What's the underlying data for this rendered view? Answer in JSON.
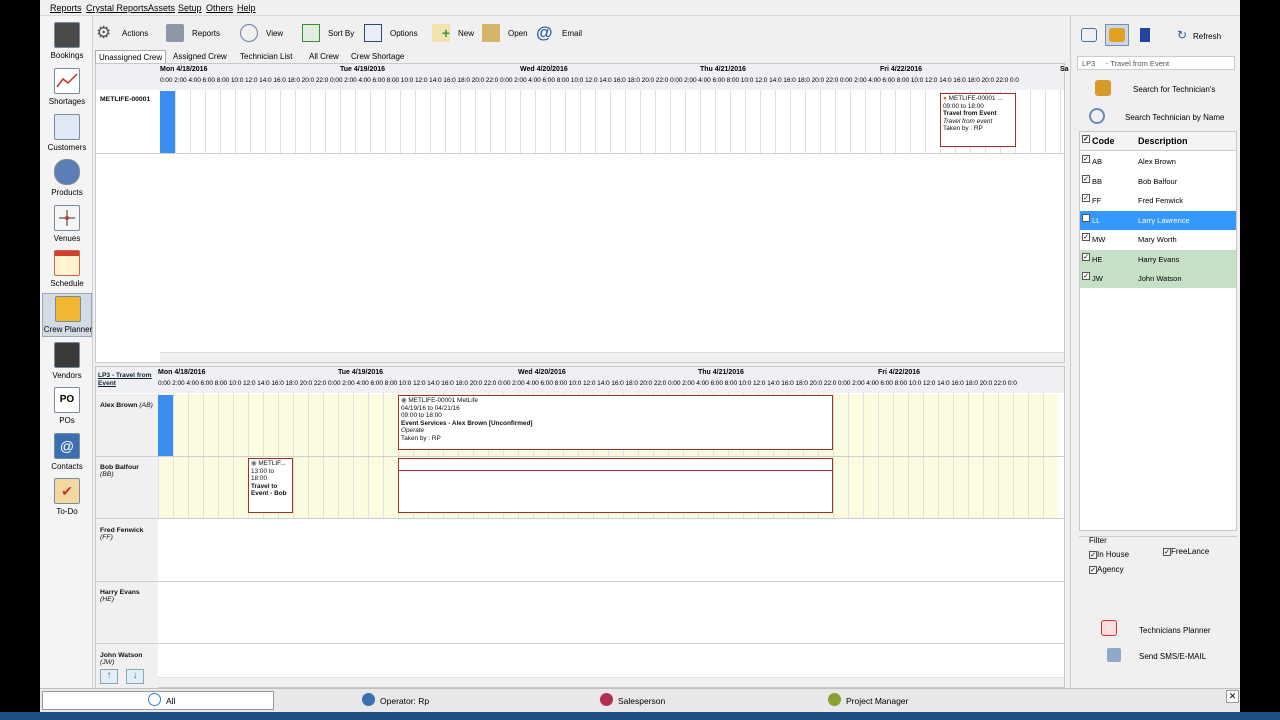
{
  "menu": [
    "Reports",
    "Crystal Reports",
    "Assets",
    "Setup",
    "Others",
    "Help"
  ],
  "nav": [
    {
      "label": "Bookings",
      "icon": "bookings-icon"
    },
    {
      "label": "Shortages",
      "icon": "shortages-chart-icon"
    },
    {
      "label": "Customers",
      "icon": "customers-icon"
    },
    {
      "label": "Products",
      "icon": "products-microphone-icon"
    },
    {
      "label": "Venues",
      "icon": "venues-icon"
    },
    {
      "label": "Schedule",
      "icon": "schedule-calendar-icon"
    },
    {
      "label": "Crew Planner",
      "icon": "crew-planner-icon"
    },
    {
      "label": "Vendors",
      "icon": "vendors-icon"
    },
    {
      "label": "POs",
      "icon": "po-icon"
    },
    {
      "label": "Contacts",
      "icon": "contacts-at-icon"
    },
    {
      "label": "To-Do",
      "icon": "todo-clipboard-icon"
    }
  ],
  "toolbar": [
    {
      "label": "Actions",
      "icon": "gear-icon"
    },
    {
      "label": "Reports",
      "icon": "printer-icon"
    },
    {
      "label": "View",
      "icon": "magnifier-icon"
    },
    {
      "label": "Sort By",
      "icon": "sort-grid-icon"
    },
    {
      "label": "Options",
      "icon": "options-monitor-icon"
    },
    {
      "label": "New",
      "icon": "new-plus-icon"
    },
    {
      "label": "Open",
      "icon": "open-folder-icon"
    },
    {
      "label": "Email",
      "icon": "at-icon"
    }
  ],
  "tabs": [
    "Unassigned Crew",
    "Assigned Crew",
    "Technician List",
    "All Crew",
    "Crew Shortage"
  ],
  "days": [
    "Mon 4/18/2016",
    "Tue 4/19/2016",
    "Wed 4/20/2016",
    "Thu 4/21/2016",
    "Fri 4/22/2016",
    "Sa"
  ],
  "hours_line": "0:00 2:00 4:00 6:00 8:00 10:0 12:0 14:0 16:0 18:0 20:0 22:0 0:00 2:00 4:00 6:00 8:00 10:0 12:0 14:0 16:0 18:0 20:0 22:0 0:00 2:00 4:00 6:00 8:00 10:0 12:0 14:0 16:0 18:0 20:0 22:0 0:00 2:00 4:00 6:00 8:00 10:0 12:0 14:0 16:0 18:0 20:0 22:0 0:00 2:00 4:00 6:00 8:00 10:0 12:0 14:0 16:0 18:0 20:0 22:0 0:0",
  "top_grid": {
    "row_label": "METLIFE-00001",
    "event": {
      "title": "METLIFE-00001 ...",
      "time": "09:00 to 18:00",
      "name": "Travel from Event",
      "sub": "Travel from event",
      "taken": "Taken by : RP"
    }
  },
  "bottom_grid": {
    "header_label": "LP3    - Travel from Event",
    "rows": [
      {
        "name": "Alex Brown",
        "code": "(AB)"
      },
      {
        "name": "Bob Balfour",
        "code": "(BB)"
      },
      {
        "name": "Fred Fenwick",
        "code": "(FF)"
      },
      {
        "name": "Harry Evans",
        "code": "(HE)"
      },
      {
        "name": "John Watson",
        "code": "(JW)"
      }
    ],
    "event_main": {
      "title": "METLIFE-00001 MetLife",
      "dates": "04/19/16 to 04/21/16",
      "time": "09:00 to 18:00",
      "name": "Event Services - Alex Brown [Unconfirmed]",
      "sub": "Operate",
      "taken": "Taken by : RP"
    },
    "event_small": {
      "title": "METLIF...",
      "time": "13:00 to 18:00",
      "name": "Travel to Event - Bob"
    }
  },
  "right": {
    "refresh": "Refresh",
    "header": "LP3     - Travel from Event",
    "search_skill": "Search for Technician's",
    "search_name": "Search Technician by Name",
    "col_code": "Code",
    "col_desc": "Description",
    "techs": [
      {
        "code": "AB",
        "name": "Alex Brown",
        "state": "normal"
      },
      {
        "code": "BB",
        "name": "Bob Balfour",
        "state": "normal"
      },
      {
        "code": "FF",
        "name": "Fred Fenwick",
        "state": "normal"
      },
      {
        "code": "LL",
        "name": "Larry Lawrence",
        "state": "selected"
      },
      {
        "code": "MW",
        "name": "Mary Worth",
        "state": "normal"
      },
      {
        "code": "HE",
        "name": "Harry Evans",
        "state": "green"
      },
      {
        "code": "JW",
        "name": "John Watson",
        "state": "green"
      }
    ],
    "filter_title": "Filter",
    "filter_inhouse": "In House",
    "filter_freelance": "FreeLance",
    "filter_agency": "Agency",
    "tech_planner": "Technicians Planner",
    "send_sms": "Send SMS/E-MAIL"
  },
  "status": [
    {
      "label": "All",
      "color": "#3a7bd5"
    },
    {
      "label": "Operator: Rp",
      "color": "#3a6fb0"
    },
    {
      "label": "Salesperson",
      "color": "#b03050"
    },
    {
      "label": "Project Manager",
      "color": "#8aa030"
    }
  ],
  "colors": {
    "selected": "#3399ff",
    "green": "#c6e0c6",
    "event_border": "#a03030",
    "blue_block": "#3b8ef0",
    "yellow": "#fbfbe0"
  }
}
